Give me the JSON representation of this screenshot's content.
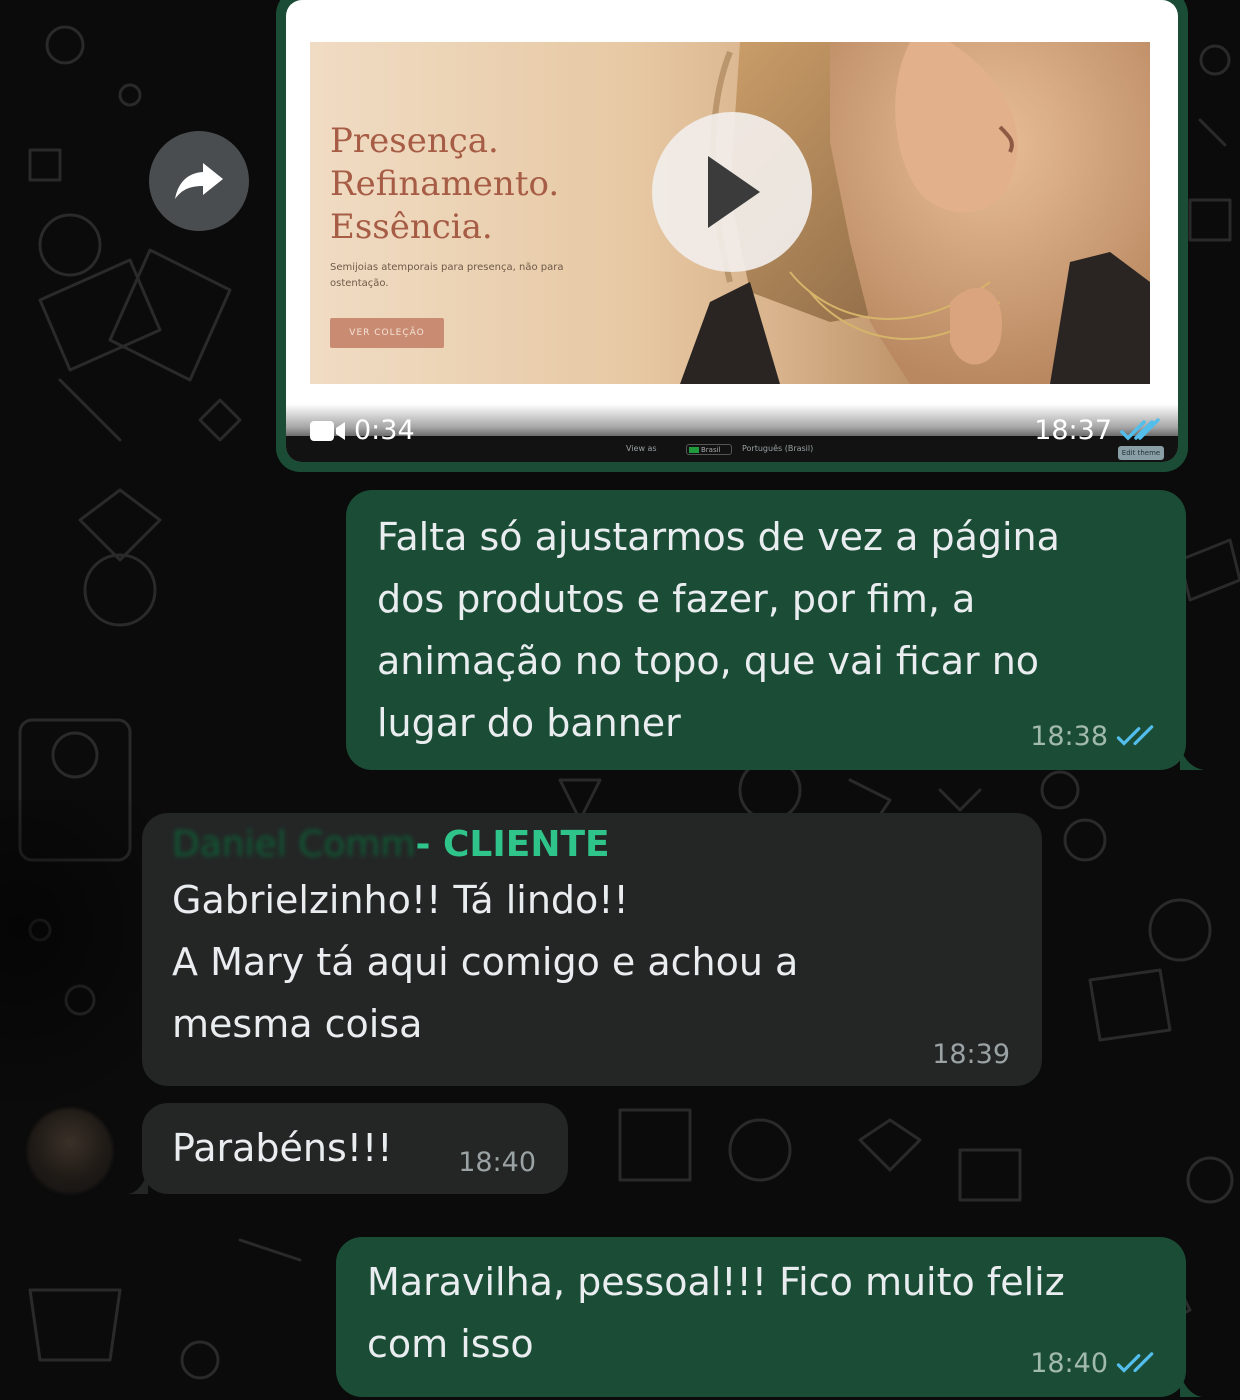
{
  "theme": {
    "outgoing_bubble": "#1b4d36",
    "incoming_bubble": "#242626",
    "sender_tag_color": "#2fc48a",
    "read_tick_color": "#53bdeb"
  },
  "video_message": {
    "banner": {
      "headline": [
        "Presença.",
        "Refinamento.",
        "Essência."
      ],
      "subtext": [
        "Semijoias atemporais para presença, não para",
        "ostentação."
      ],
      "cta_label": "VER COLEÇÃO"
    },
    "browser_strip": {
      "view_as": "View as",
      "country": "Brasil",
      "language": "Português (Brasil)",
      "button": "Edit theme"
    },
    "duration": "0:34",
    "time": "18:37",
    "status_icon": "double-check-read-icon"
  },
  "messages": [
    {
      "direction": "outgoing",
      "lines": [
        "Falta só ajustarmos de vez a página",
        "dos produtos e fazer, por fim, a",
        "animação no topo, que vai ficar no",
        "lugar do banner"
      ],
      "time": "18:38",
      "status_icon": "double-check-read-icon"
    },
    {
      "direction": "incoming",
      "sender_name": "Daniel Comm",
      "sender_tag": " - CLIENTE",
      "lines": [
        "Gabrielzinho!! Tá lindo!!",
        "A Mary tá aqui comigo e achou a",
        "mesma coisa"
      ],
      "time": "18:39"
    },
    {
      "direction": "incoming",
      "lines": [
        "Parabéns!!!"
      ],
      "time": "18:40"
    },
    {
      "direction": "outgoing",
      "lines": [
        "Maravilha, pessoal!!! Fico muito feliz",
        "com isso"
      ],
      "time": "18:40",
      "status_icon": "double-check-read-icon"
    }
  ]
}
